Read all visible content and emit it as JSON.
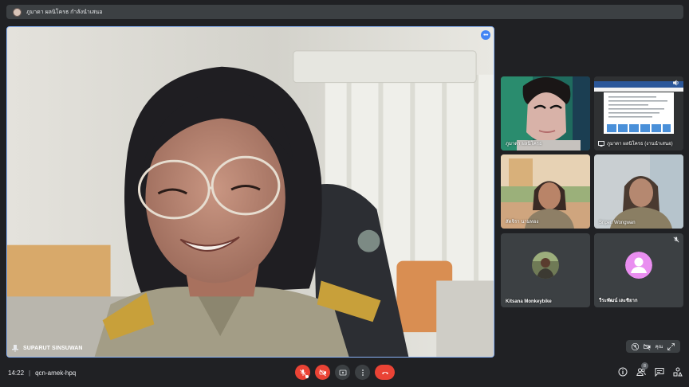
{
  "presenting": {
    "text": "ภูมาดา ผลนิโครธ กำลังนำเสนอ"
  },
  "main_video": {
    "participant_name": "SUPARUT SINSUWAN",
    "more_label": "•••"
  },
  "tiles": [
    {
      "name": "ภูมาดา ผลนิโครธ"
    },
    {
      "name": "ภูมาดา ผลนิโครธ (งานนำเสนอ)"
    },
    {
      "name": "สัตจิรา นามทอง"
    },
    {
      "name": "Sripen Wongwan"
    },
    {
      "name": "Kitsana Monkeybike"
    },
    {
      "name": "วีระพัฒน์ เละชิยาก"
    }
  ],
  "self_view": {
    "label": "คุณ"
  },
  "bottom": {
    "time": "14:22",
    "separator": "|",
    "meeting_code": "qcn-amek-hpq",
    "participant_count": "8"
  },
  "colors": {
    "background": "#202124",
    "surface": "#3c4043",
    "danger": "#ea4335",
    "accent": "#8ab4f8",
    "avatar_pink": "#e98ef0"
  },
  "icons": {
    "mic": "mic-off-icon",
    "camera": "camera-off-icon",
    "present": "present-icon",
    "more": "more-vert-icon",
    "hangup": "hangup-icon",
    "info": "info-icon",
    "people": "people-icon",
    "chat": "chat-icon",
    "activities": "activities-icon"
  }
}
